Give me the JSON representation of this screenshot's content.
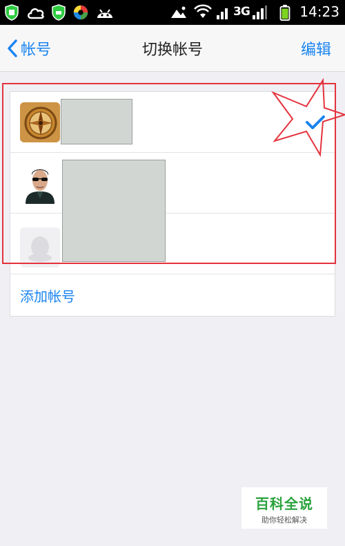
{
  "status_bar": {
    "time": "14:23",
    "network": "3G",
    "icons": [
      "shield-icon",
      "cloud-icon",
      "shield-icon",
      "swirl-app-icon",
      "android-icon",
      "photo-icon",
      "wifi-icon",
      "signal-icon",
      "battery-icon"
    ]
  },
  "nav": {
    "back_label": "帐号",
    "title": "切换帐号",
    "edit_label": "编辑"
  },
  "accounts": [
    {
      "avatar": "compass-avatar",
      "selected": true
    },
    {
      "avatar": "man-sunglasses-avatar",
      "selected": false
    },
    {
      "avatar": "default-penguin-avatar",
      "selected": false
    }
  ],
  "add_account_label": "添加帐号",
  "watermark": {
    "title": "百科全说",
    "subtitle": "助你轻松解决"
  },
  "colors": {
    "accent": "#1a84f0",
    "highlight": "#e4323c",
    "background": "#efeff4"
  }
}
